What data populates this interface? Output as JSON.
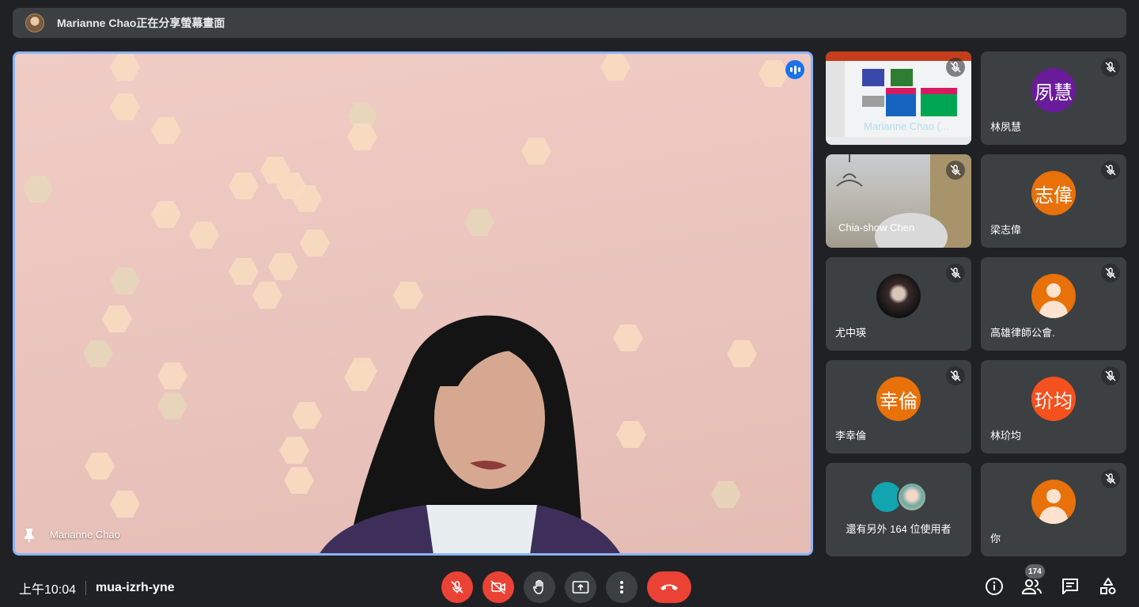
{
  "banner": {
    "text": "Marianne Chao正在分享螢幕畫面"
  },
  "main": {
    "presenter_name": "Marianne Chao"
  },
  "tiles": [
    {
      "name": "Marianne Chao (...",
      "type": "screen"
    },
    {
      "name": "林夙慧",
      "initials": "夙慧",
      "color": "#6a1b9a"
    },
    {
      "name": "Chia-show Chen",
      "type": "camera"
    },
    {
      "name": "梁志偉",
      "initials": "志偉",
      "color": "#e8710a"
    },
    {
      "name": "尤中瑛",
      "type": "photo"
    },
    {
      "name": "高雄律師公會.",
      "type": "generic"
    },
    {
      "name": "李幸倫",
      "initials": "幸倫",
      "color": "#e8710a"
    },
    {
      "name": "林玠均",
      "initials": "玠均",
      "color": "#f4511e"
    },
    {
      "name": "還有另外 164 位使用者",
      "type": "more"
    },
    {
      "name": "你",
      "type": "generic"
    }
  ],
  "footer": {
    "time": "上午10:04",
    "meeting_code": "mua-izrh-yne",
    "participant_count": "174"
  },
  "controls": [
    "mic-off",
    "camera-off",
    "raise-hand",
    "present",
    "more-options",
    "leave-call"
  ],
  "colors": {
    "accent": "#8ab4f8",
    "danger": "#ea4335",
    "tile": "#3c4043",
    "background": "#202124"
  }
}
